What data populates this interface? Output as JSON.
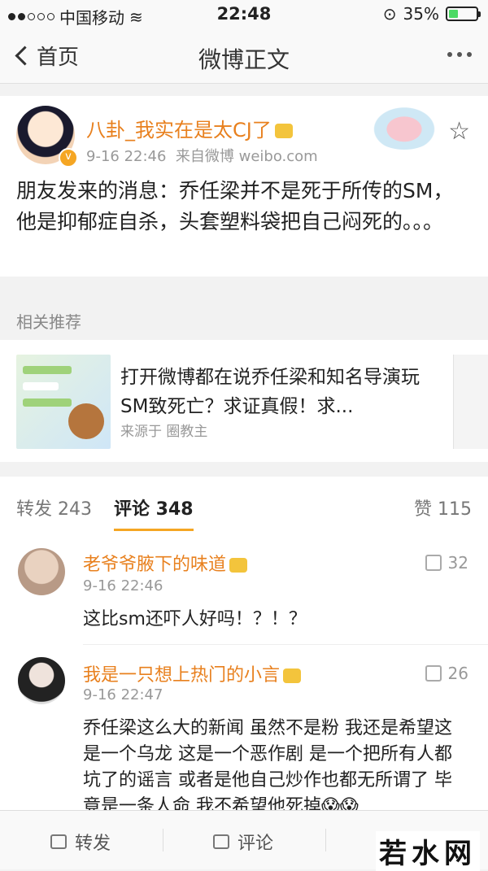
{
  "status_bar": {
    "carrier": "中国移动",
    "time": "22:48",
    "battery": "35%",
    "battery_level": 0.35
  },
  "nav": {
    "back_label": "首页",
    "title": "微博正文"
  },
  "post": {
    "username": "八卦_我实在是太CJ了",
    "time": "9-16 22:46",
    "source": "来自微博 weibo.com",
    "text": "朋友发来的消息：乔任梁并不是死于所传的SM，他是抑郁症自杀，头套塑料袋把自己闷死的。。。"
  },
  "related": {
    "label": "相关推荐",
    "title": "打开微博都在说乔任梁和知名导演玩SM致死亡？求证真假！求...",
    "source": "来源于 圈教主"
  },
  "tabs": {
    "repost": "转发 243",
    "comment": "评论 348",
    "like": "赞 115"
  },
  "comments": [
    {
      "username": "老爷爷腋下的味道",
      "time": "9-16 22:46",
      "likes": "32",
      "text": "这比sm还吓人好吗！？！？"
    },
    {
      "username": "我是一只想上热门的小言",
      "time": "9-16 22:47",
      "likes": "26",
      "text": "乔任梁这么大的新闻 虽然不是粉 我还是希望这是一个乌龙 这是一个恶作剧 是一个把所有人都坑了的谣言 或者是他自己炒作也都无所谓了 毕竟是一条人命 我不希望他死掉😱😱"
    }
  ],
  "toolbar": {
    "repost": "转发",
    "comment": "评论"
  },
  "watermark": "若水网",
  "colors": {
    "accent": "#f5a623",
    "username": "#e8801e"
  }
}
